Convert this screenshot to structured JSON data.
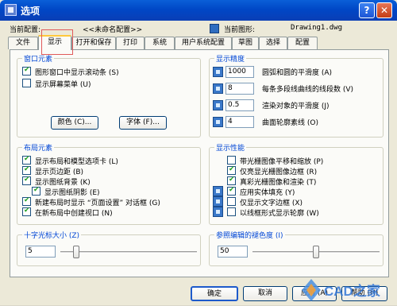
{
  "window": {
    "title": "选项"
  },
  "header": {
    "current_profile_label": "当前配置:",
    "current_profile_value": "<<未命名配置>>",
    "current_drawing_label": "当前图形:",
    "current_drawing_value": "Drawing1.dwg"
  },
  "tabs": [
    "文件",
    "显示",
    "打开和保存",
    "打印",
    "系统",
    "用户系统配置",
    "草图",
    "选择",
    "配置"
  ],
  "window_elements": {
    "title": "窗口元素",
    "checkboxes": [
      {
        "label": "图形窗口中显示滚动条 (S)",
        "checked": true
      },
      {
        "label": "显示屏幕菜单 (U)",
        "checked": false
      }
    ],
    "colors_button": "颜色 (C)...",
    "fonts_button": "字体 (F)..."
  },
  "display_resolution": {
    "title": "显示精度",
    "rows": [
      {
        "value": "1000",
        "label": "圆弧和圆的平滑度 (A)"
      },
      {
        "value": "8",
        "label": "每条多段线曲线的线段数 (V)"
      },
      {
        "value": "0.5",
        "label": "渲染对象的平滑度 (J)"
      },
      {
        "value": "4",
        "label": "曲面轮廓素线 (O)"
      }
    ]
  },
  "layout_elements": {
    "title": "布局元素",
    "checkboxes": [
      {
        "label": "显示布局和模型选项卡 (L)",
        "checked": true
      },
      {
        "label": "显示页边距 (B)",
        "checked": true
      },
      {
        "label": "显示图纸背景 (K)",
        "checked": true
      },
      {
        "label": "显示图纸阴影 (E)",
        "checked": true
      },
      {
        "label": "新建布局时显示 “页面设置” 对话框 (G)",
        "checked": true
      },
      {
        "label": "在新布局中创建视口 (N)",
        "checked": true
      }
    ]
  },
  "display_performance": {
    "title": "显示性能",
    "checkboxes": [
      {
        "label": "带光栅图像平移和缩放 (P)",
        "checked": false
      },
      {
        "label": "仅亮显光栅图像边框 (R)",
        "checked": true
      },
      {
        "label": "真彩光栅图像和渲染 (T)",
        "checked": true
      },
      {
        "label": "应用实体填充 (Y)",
        "checked": true
      },
      {
        "label": "仅显示文字边框 (X)",
        "checked": false
      },
      {
        "label": "以线框形式显示轮廓 (W)",
        "checked": false
      }
    ]
  },
  "crosshair_size": {
    "title": "十字光标大小 (Z)",
    "value": "5"
  },
  "xref_fade": {
    "title": "参照编辑的褪色度 (I)",
    "value": "50"
  },
  "footer": {
    "ok": "确定",
    "cancel": "取消",
    "apply": "应用 (A)",
    "help": "帮助 (H)"
  },
  "watermark": {
    "text": "CAD之家"
  }
}
